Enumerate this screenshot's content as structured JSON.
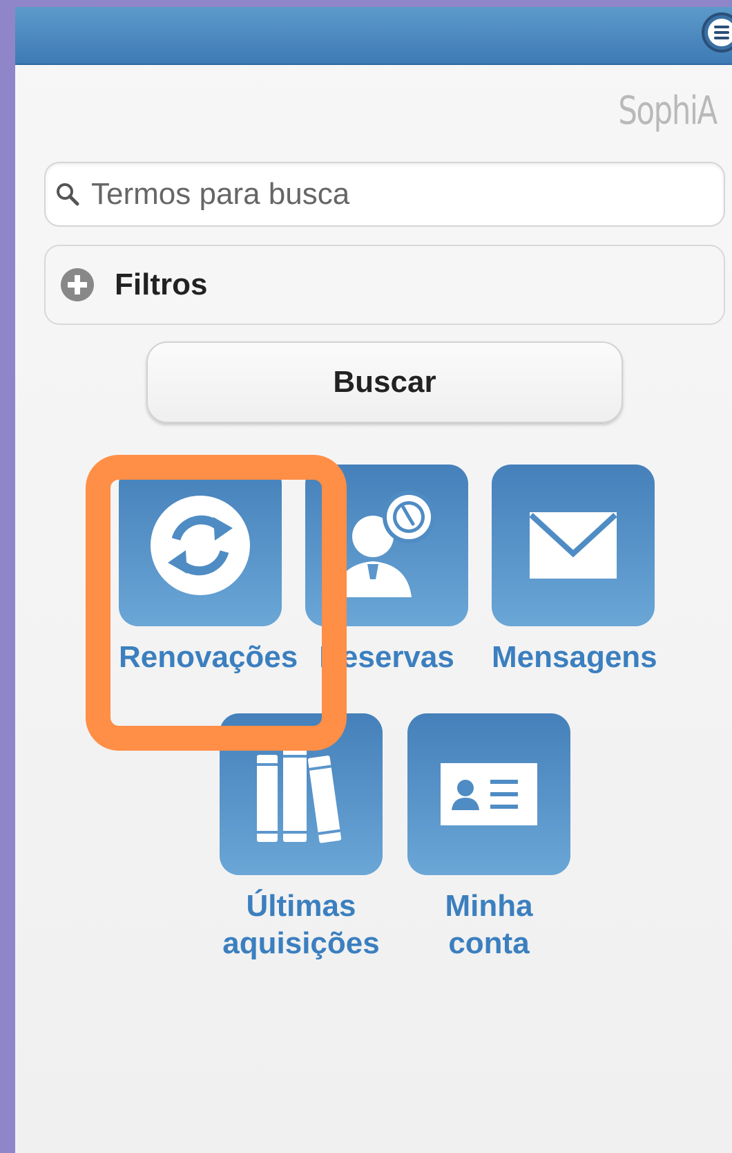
{
  "search": {
    "placeholder": "Termos para busca"
  },
  "logo": "SophiA",
  "filters": {
    "label": "Filtros"
  },
  "buscar": {
    "label": "Buscar"
  },
  "tiles": [
    {
      "label": "Renovações",
      "icon": "refresh-icon"
    },
    {
      "label": "Reservas",
      "icon": "person-clock-icon"
    },
    {
      "label": "Mensagens",
      "icon": "envelope-icon"
    },
    {
      "label_line1": "Últimas",
      "label_line2": "aquisições",
      "icon": "books-icon"
    },
    {
      "label_line1": "Minha",
      "label_line2": "conta",
      "icon": "id-card-icon"
    }
  ],
  "colors": {
    "accent": "#3b7fbf",
    "highlight": "#ff8e47",
    "topbar": "#4b88c0"
  }
}
